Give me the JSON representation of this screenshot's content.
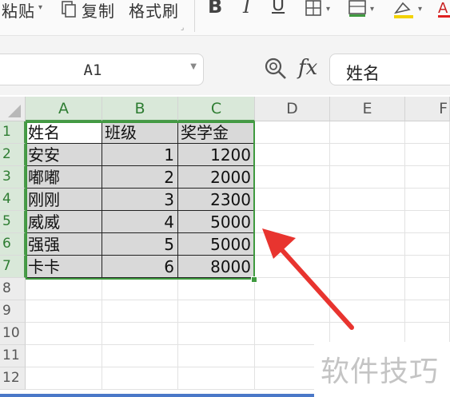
{
  "ribbon": {
    "paste_label": "粘贴",
    "copy_label": "复制",
    "format_painter_label": "格式刷",
    "bold_label": "B",
    "italic_label": "I",
    "underline_label": "U"
  },
  "formula_bar": {
    "name_box": "A1",
    "fx_label": "fx",
    "content": "姓名"
  },
  "columns": [
    "A",
    "B",
    "C",
    "D",
    "E",
    "F"
  ],
  "rows": [
    "1",
    "2",
    "3",
    "4",
    "5",
    "6",
    "7",
    "8",
    "9",
    "10",
    "11",
    "12"
  ],
  "table": {
    "header": [
      "姓名",
      "班级",
      "奖学金"
    ],
    "rows": [
      [
        "安安",
        "1",
        "1200"
      ],
      [
        "嘟嘟",
        "2",
        "2000"
      ],
      [
        "刚刚",
        "3",
        "2300"
      ],
      [
        "威威",
        "4",
        "5000"
      ],
      [
        "强强",
        "5",
        "5000"
      ],
      [
        "卡卡",
        "6",
        "8000"
      ]
    ]
  },
  "watermark_text": "软件技巧",
  "colors": {
    "selection": "#3f9a3f",
    "annotation_arrow": "#e8342f",
    "cell_fill": "#d9d9d9"
  },
  "icons": [
    "paste-dropdown-icon",
    "copy-icon",
    "borders-icon",
    "fill-color-icon",
    "font-color-icon",
    "zoom-icon",
    "name-box-dropdown-icon"
  ]
}
